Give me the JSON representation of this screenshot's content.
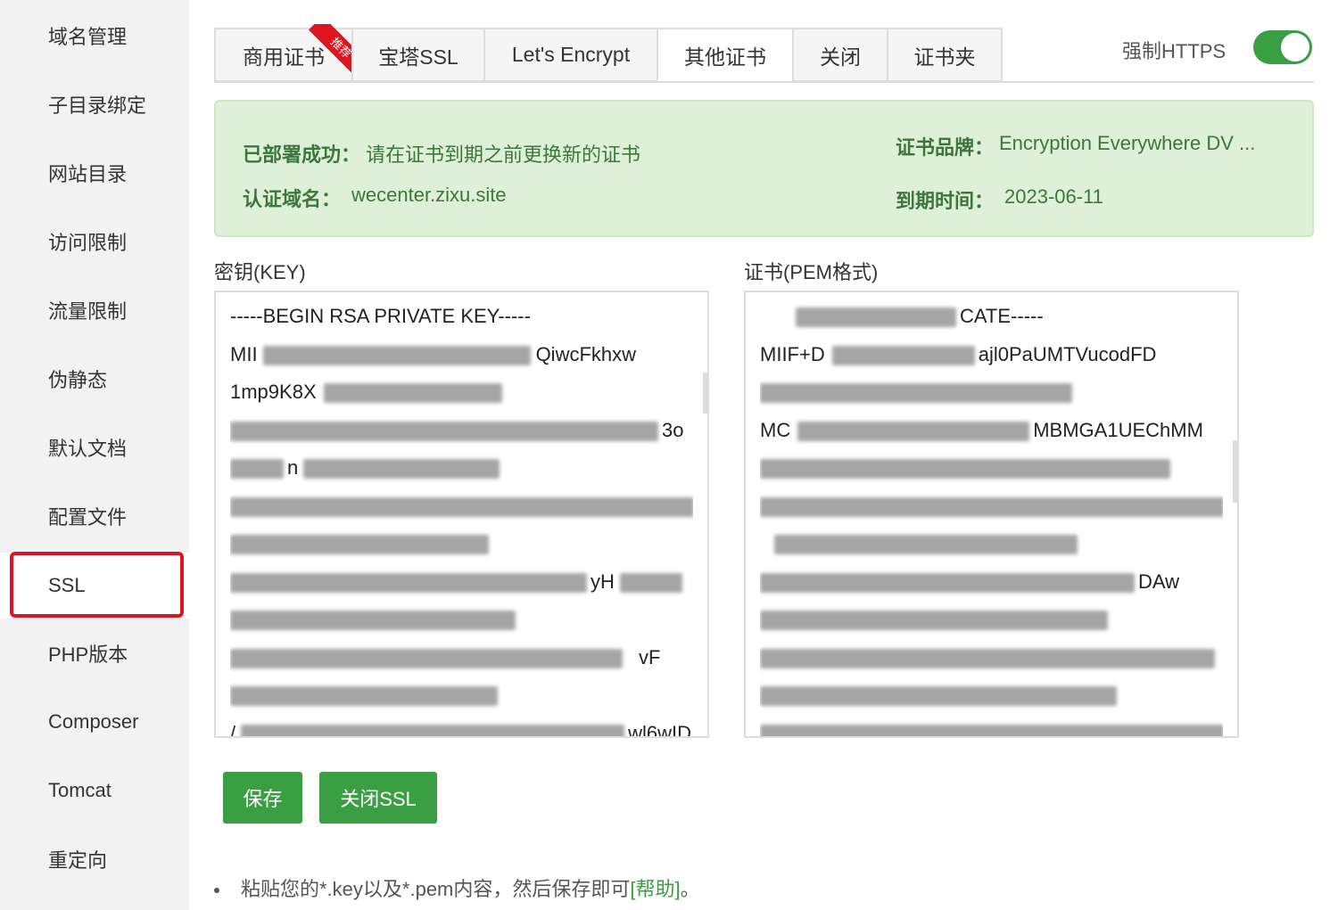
{
  "sidebar": {
    "items": [
      {
        "label": "域名管理"
      },
      {
        "label": "子目录绑定"
      },
      {
        "label": "网站目录"
      },
      {
        "label": "访问限制"
      },
      {
        "label": "流量限制"
      },
      {
        "label": "伪静态"
      },
      {
        "label": "默认文档"
      },
      {
        "label": "配置文件"
      },
      {
        "label": "SSL",
        "active": true
      },
      {
        "label": "PHP版本"
      },
      {
        "label": "Composer"
      },
      {
        "label": "Tomcat"
      },
      {
        "label": "重定向"
      }
    ]
  },
  "tabs": [
    {
      "label": "商用证书",
      "badge": "推荐"
    },
    {
      "label": "宝塔SSL"
    },
    {
      "label": "Let's Encrypt"
    },
    {
      "label": "其他证书",
      "active": true
    },
    {
      "label": "关闭"
    },
    {
      "label": "证书夹"
    }
  ],
  "https_toggle": {
    "label": "强制HTTPS",
    "on": true
  },
  "status": {
    "deploy_label": "已部署成功：",
    "deploy_text": "请在证书到期之前更换新的证书",
    "domain_label": "认证域名：",
    "domain_value": "wecenter.zixu.site",
    "brand_label": "证书品牌：",
    "brand_value": "Encryption Everywhere DV ...",
    "expiry_label": "到期时间：",
    "expiry_value": "2023-06-11"
  },
  "key_field": {
    "label": "密钥(KEY)",
    "lines": [
      "-----BEGIN RSA PRIVATE KEY-----",
      "MII",
      "1mp9K8X",
      "",
      "",
      "",
      "",
      "",
      "",
      "",
      "",
      "/"
    ],
    "tails": [
      "",
      "QiwcFkhxw",
      "",
      "3o",
      "n",
      "",
      "",
      "yH",
      "",
      "vF",
      "",
      "wl6wID"
    ]
  },
  "cert_field": {
    "label": "证书(PEM格式)",
    "lines": [
      "CATE-----",
      "MIIF+D",
      "",
      "MC",
      "",
      "",
      "",
      "",
      "",
      "",
      "",
      ""
    ],
    "tails": [
      "",
      "ajl0PaUMTVucodFD",
      "",
      "MBMGA1UEChMM",
      "",
      "",
      "",
      "DAw",
      "",
      "",
      "",
      ""
    ]
  },
  "buttons": {
    "save": "保存",
    "close_ssl": "关闭SSL"
  },
  "tip": {
    "text": "粘贴您的*.key以及*.pem内容，然后保存即可",
    "link": "[帮助]",
    "end": "。"
  },
  "colors": {
    "accent": "#3a9e42",
    "highlight": "#e0141e",
    "info_bg": "#dff0d8"
  }
}
